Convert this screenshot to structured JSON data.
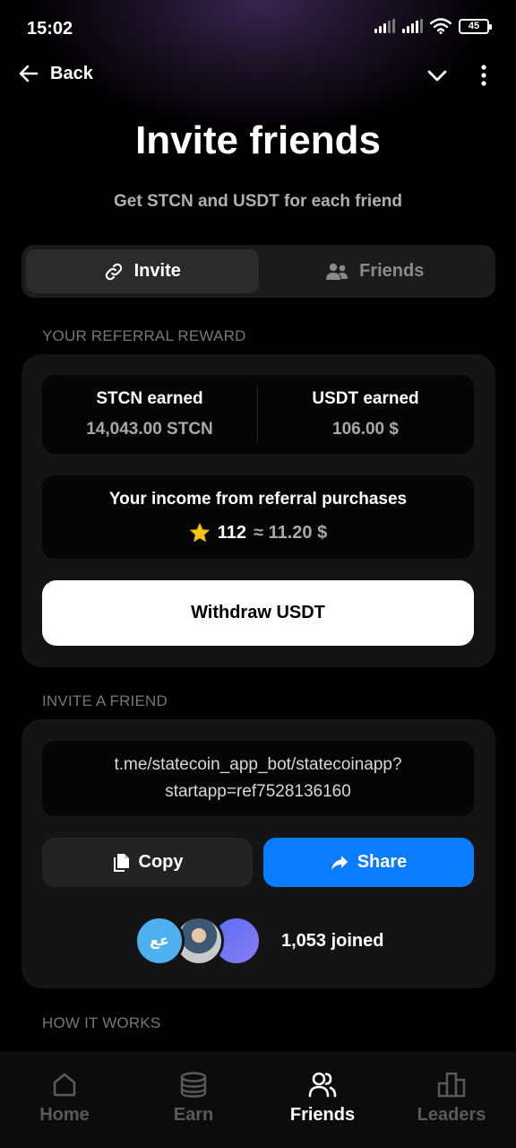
{
  "status_bar": {
    "time": "15:02",
    "battery": "45"
  },
  "top_nav": {
    "back_label": "Back"
  },
  "header": {
    "title": "Invite friends",
    "subtitle": "Get STCN and USDT for each friend"
  },
  "tabs": [
    {
      "label": "Invite",
      "icon": "link-icon",
      "active": true
    },
    {
      "label": "Friends",
      "icon": "users-icon",
      "active": false
    }
  ],
  "referral": {
    "section_label": "YOUR REFERRAL REWARD",
    "stcn_title": "STCN earned",
    "stcn_value": "14,043.00 STCN",
    "usdt_title": "USDT earned",
    "usdt_value": "106.00 $",
    "income_title": "Your income from referral purchases",
    "income_stars": "112",
    "income_approx": "≈ 11.20 $",
    "withdraw_label": "Withdraw USDT"
  },
  "invite": {
    "section_label": "INVITE A FRIEND",
    "link_line1": "t.me/statecoin_app_bot/statecoinapp?",
    "link_line2": "startapp=ref7528136160",
    "copy_label": "Copy",
    "share_label": "Share",
    "avatar_initials": "عع",
    "joined_text": "1,053 joined"
  },
  "how_it_works": {
    "section_label": "HOW IT WORKS"
  },
  "bottom_nav": [
    {
      "label": "Home",
      "icon": "home-icon",
      "active": false
    },
    {
      "label": "Earn",
      "icon": "coins-icon",
      "active": false
    },
    {
      "label": "Friends",
      "icon": "friends-icon",
      "active": true
    },
    {
      "label": "Leaders",
      "icon": "chart-icon",
      "active": false
    }
  ],
  "colors": {
    "accent_blue": "#0a7cff",
    "card": "#141414",
    "star": "#f5c518"
  }
}
